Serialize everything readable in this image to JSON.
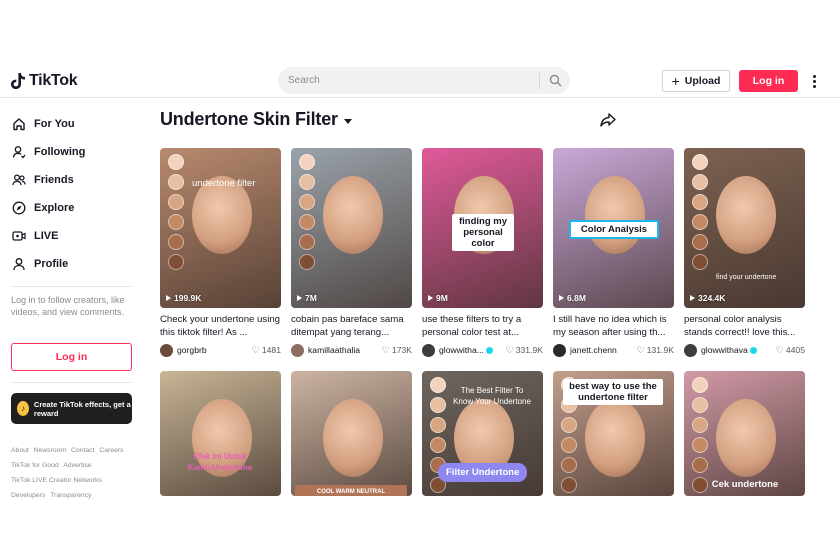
{
  "header": {
    "logo": "TikTok",
    "search_placeholder": "Search",
    "upload_label": "Upload",
    "login_label": "Log in"
  },
  "sidebar": {
    "nav": [
      {
        "label": "For You",
        "icon": "home-icon"
      },
      {
        "label": "Following",
        "icon": "following-icon"
      },
      {
        "label": "Friends",
        "icon": "friends-icon"
      },
      {
        "label": "Explore",
        "icon": "compass-icon"
      },
      {
        "label": "LIVE",
        "icon": "live-icon"
      },
      {
        "label": "Profile",
        "icon": "profile-icon"
      }
    ],
    "login_prompt": "Log in to follow creators, like videos, and view comments.",
    "login_label": "Log in",
    "effects_banner": "Create TikTok effects, get a reward",
    "footer_line1": [
      "About",
      "Newsroom",
      "Contact",
      "Careers"
    ],
    "footer_line2": [
      "TikTok for Good",
      "Advertise"
    ],
    "footer_line3": "TikTok LIVE Creator Networks",
    "footer_line4": [
      "Developers",
      "Transparency"
    ]
  },
  "main": {
    "title": "Undertone Skin Filter",
    "videos": [
      {
        "views": "199.9K",
        "caption": "Check your undertone using this tiktok filter! As ...",
        "user": "gorgbrb",
        "verified": false,
        "likes": "1481",
        "overlay": "undertone filter",
        "bg": "#b98a6e",
        "avatar_color": "#6b4b3a"
      },
      {
        "views": "7M",
        "caption": "cobain pas bareface sama ditempat yang terang...",
        "user": "kamillaathalia",
        "verified": false,
        "likes": "173K",
        "overlay": "",
        "bg": "#9aa3ab",
        "avatar_color": "#8c6e63"
      },
      {
        "views": "9M",
        "caption": "use these filters to try a personal color test at...",
        "user": "glowwitha...",
        "verified": true,
        "likes": "331.9K",
        "overlay": "finding my personal color",
        "bg": "#e05a9a",
        "avatar_color": "#3d3d3d"
      },
      {
        "views": "6.8M",
        "caption": "I still have no idea which is my season after using th...",
        "user": "janett.chenn",
        "verified": false,
        "likes": "131.9K",
        "overlay": "Color Analysis",
        "bg": "#c9a8d8",
        "avatar_color": "#2a2a2a"
      },
      {
        "views": "324.4K",
        "caption": "personal color analysis stands correct!! love this...",
        "user": "glowwithava",
        "verified": true,
        "likes": "4405",
        "overlay": "find your undertone",
        "bg": "#7d6252",
        "avatar_color": "#3d3d3d"
      },
      {
        "views": "",
        "caption": "",
        "user": "",
        "verified": false,
        "likes": "",
        "overlay": "Efek ini Untuk Kamu Undertone",
        "bg": "#c7b596",
        "avatar_color": "#888"
      },
      {
        "views": "",
        "caption": "",
        "user": "",
        "verified": false,
        "likes": "",
        "overlay": "COOL  WARM  NEUTRAL",
        "bg": "#cdb4a2",
        "avatar_color": "#888"
      },
      {
        "views": "",
        "caption": "",
        "user": "",
        "verified": false,
        "likes": "",
        "overlay": "The Best Filter To Know Your Undertone",
        "bg": "#6f6660",
        "avatar_color": "#888",
        "badge": "Filter Undertone"
      },
      {
        "views": "",
        "caption": "",
        "user": "",
        "verified": false,
        "likes": "",
        "overlay": "best way to use the undertone filter",
        "bg": "#c39e8c",
        "avatar_color": "#888"
      },
      {
        "views": "",
        "caption": "",
        "user": "",
        "verified": false,
        "likes": "",
        "overlay": "Cek undertone",
        "bg": "#d29aa7",
        "avatar_color": "#888"
      }
    ]
  },
  "colors": {
    "brand": "#fe2c55",
    "text": "#161823",
    "muted": "#8a8b91",
    "verified": "#20d5ec"
  }
}
